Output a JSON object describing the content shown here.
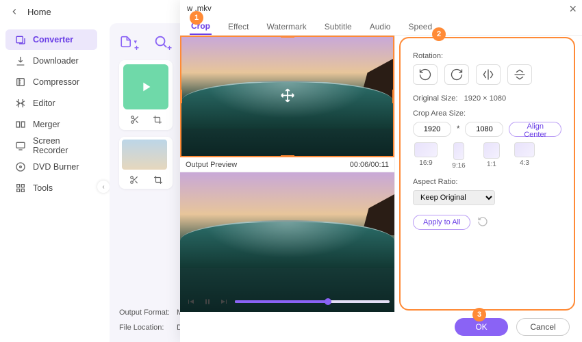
{
  "topbar": {
    "home": "Home"
  },
  "sidebar": {
    "items": [
      {
        "label": "Converter"
      },
      {
        "label": "Downloader"
      },
      {
        "label": "Compressor"
      },
      {
        "label": "Editor"
      },
      {
        "label": "Merger"
      },
      {
        "label": "Screen Recorder"
      },
      {
        "label": "DVD Burner"
      },
      {
        "label": "Tools"
      }
    ]
  },
  "content": {
    "output_format_label": "Output Format:",
    "output_format_value": "M",
    "file_location_label": "File Location:",
    "file_location_value": "D:"
  },
  "modal": {
    "filename": "w      .mkv",
    "tabs": [
      "Crop",
      "Effect",
      "Watermark",
      "Subtitle",
      "Audio",
      "Speed"
    ],
    "active_tab": 0,
    "output_preview_label": "Output Preview",
    "time": "00:06/00:11",
    "panel": {
      "rotation_label": "Rotation:",
      "rotate_ccw": "90°",
      "rotate_cw": "90°",
      "original_size_label": "Original Size:",
      "original_size_value": "1920 × 1080",
      "crop_area_label": "Crop Area Size:",
      "crop_w": "1920",
      "crop_h": "1080",
      "crop_sep": "*",
      "align_center": "Align Center",
      "ratios": [
        {
          "key": "169",
          "label": "16:9"
        },
        {
          "key": "916",
          "label": "9:16"
        },
        {
          "key": "11",
          "label": "1:1"
        },
        {
          "key": "43",
          "label": "4:3"
        }
      ],
      "aspect_ratio_label": "Aspect Ratio:",
      "aspect_ratio_value": "Keep Original",
      "apply_all": "Apply to All"
    },
    "footer": {
      "ok": "OK",
      "cancel": "Cancel"
    }
  },
  "callouts": {
    "c1": "1",
    "c2": "2",
    "c3": "3"
  }
}
